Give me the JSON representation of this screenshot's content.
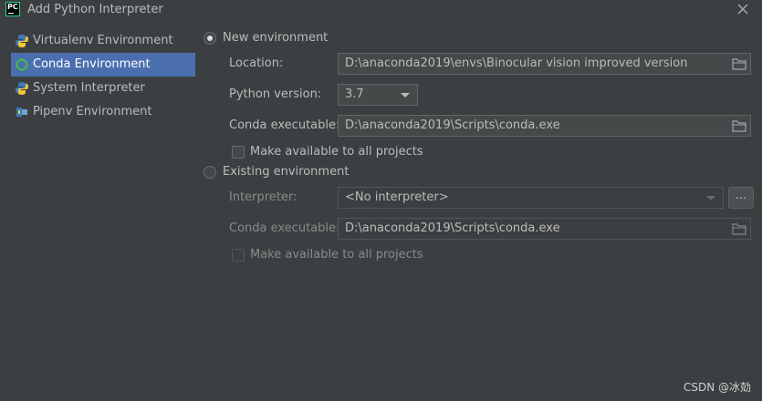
{
  "window": {
    "title": "Add Python Interpreter",
    "app_icon_text": "PC",
    "app_icon": "pycharm-icon",
    "close_icon": "close-icon"
  },
  "sidebar": {
    "items": [
      {
        "label": "Virtualenv Environment",
        "icon": "python-icon",
        "selected": false
      },
      {
        "label": "Conda Environment",
        "icon": "conda-icon",
        "selected": true
      },
      {
        "label": "System Interpreter",
        "icon": "python-icon",
        "selected": false
      },
      {
        "label": "Pipenv Environment",
        "icon": "pipenv-icon",
        "selected": false
      }
    ]
  },
  "new_env": {
    "radio_label": "New environment",
    "selected": true,
    "location_label": "Location:",
    "location_value": "D:\\anaconda2019\\envs\\Binocular vision improved version",
    "python_version_label": "Python version:",
    "python_version_value": "3.7",
    "conda_label": "Conda executable:",
    "conda_value": "D:\\anaconda2019\\Scripts\\conda.exe",
    "make_available_label": "Make available to all projects",
    "make_available_checked": false
  },
  "existing_env": {
    "radio_label": "Existing environment",
    "selected": false,
    "interpreter_label": "Interpreter:",
    "interpreter_value": "<No interpreter>",
    "more_button": "...",
    "conda_label": "Conda executable:",
    "conda_value": "D:\\anaconda2019\\Scripts\\conda.exe",
    "make_available_label": "Make available to all projects",
    "make_available_checked": false
  },
  "watermark": "CSDN @冰勀",
  "colors": {
    "background": "#3c3f41",
    "selection": "#4b6eaf",
    "text": "#bbbbbb",
    "field_bg": "#45494a"
  }
}
